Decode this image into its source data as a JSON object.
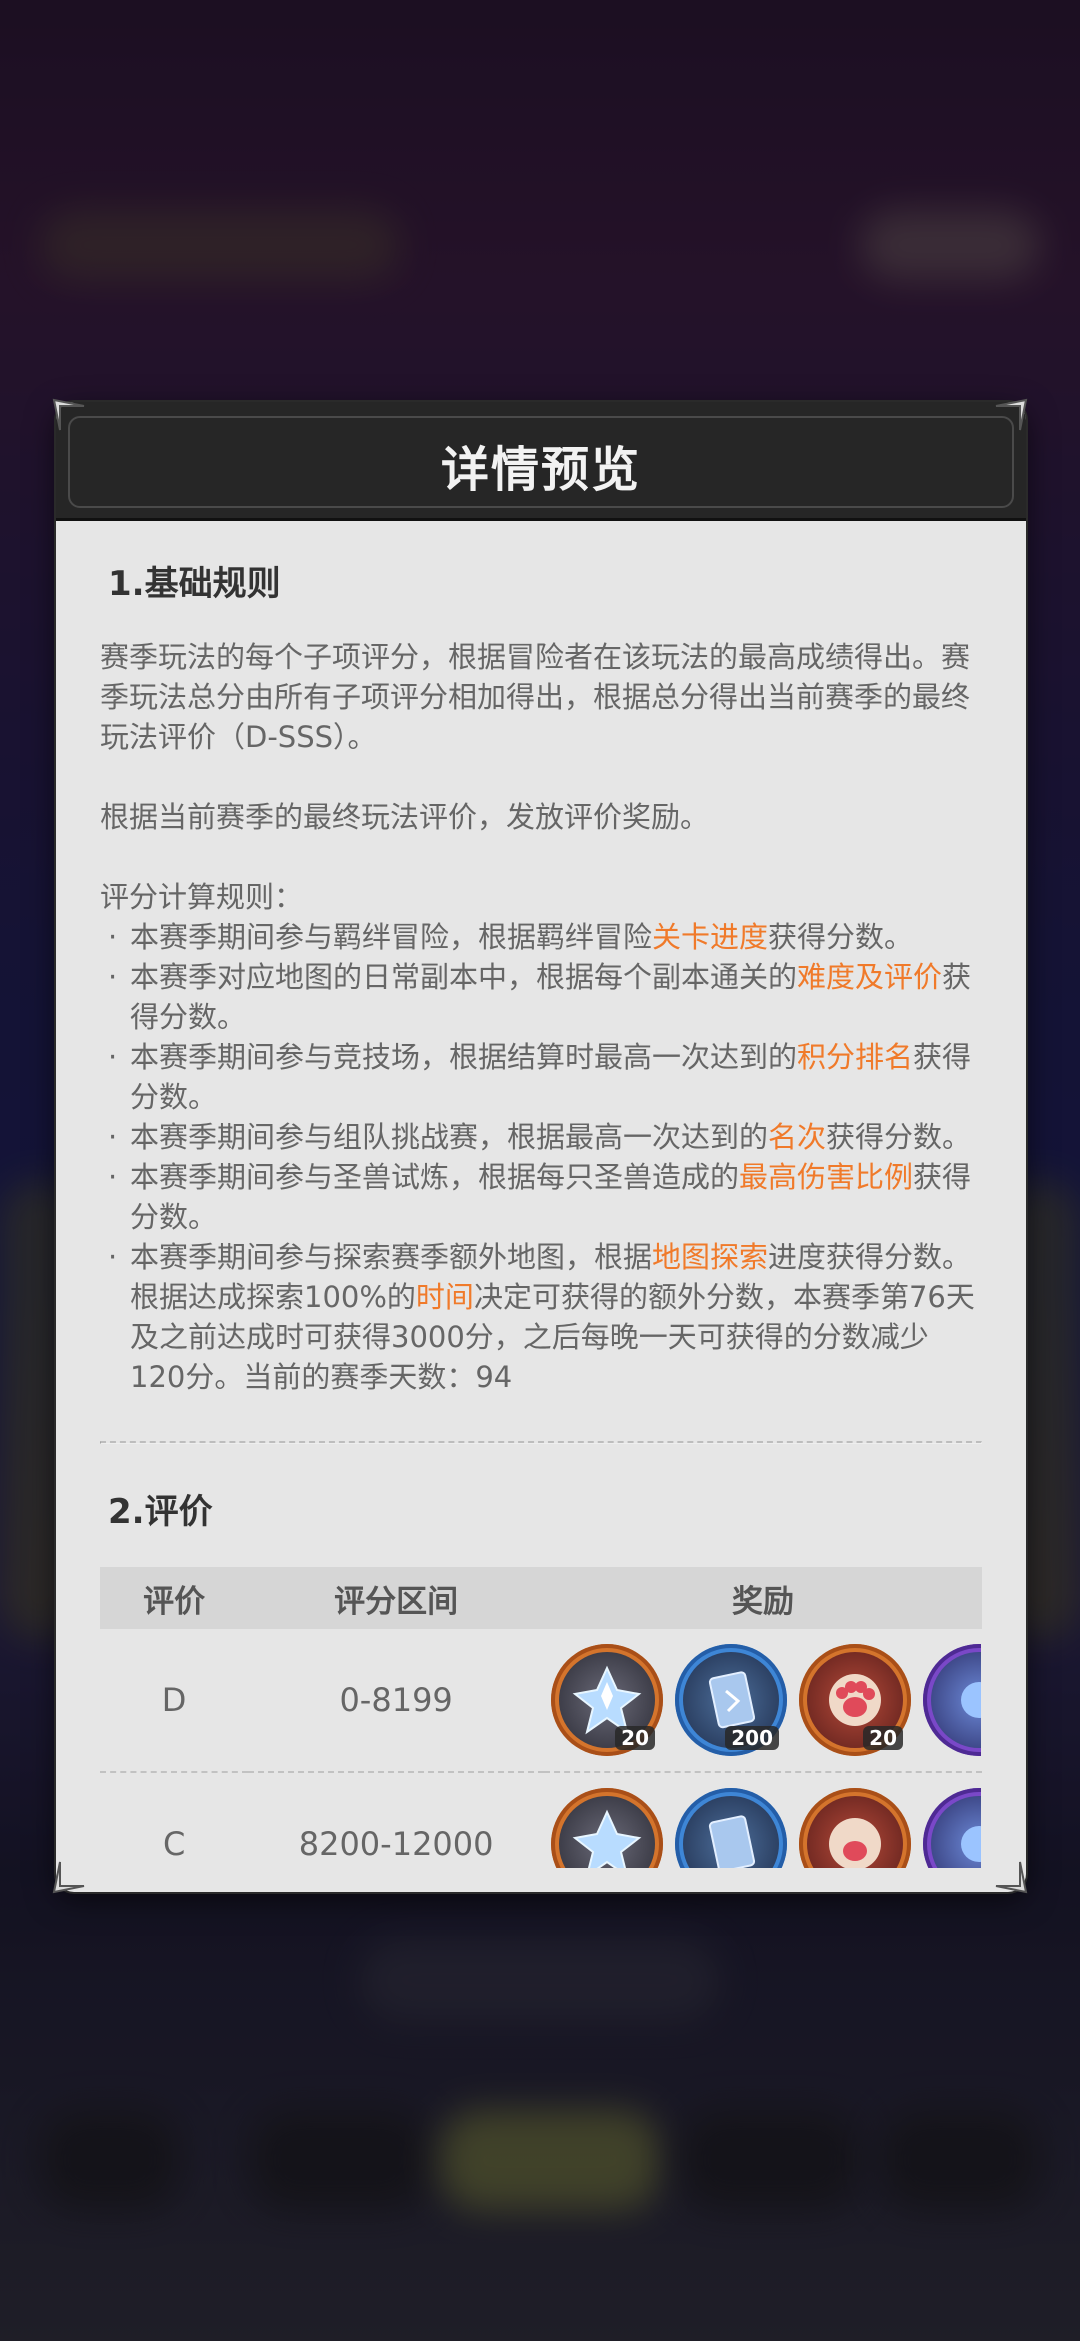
{
  "panel": {
    "title": "详情预览"
  },
  "section1": {
    "title": "1.基础规则",
    "intro": "赛季玩法的每个子项评分，根据冒险者在该玩法的最高成绩得出。赛季玩法总分由所有子项评分相加得出，根据总分得出当前赛季的最终玩法评价（D-SSS）。",
    "reward_note": "根据当前赛季的最终玩法评价，发放评价奖励。",
    "rules_heading": "评分计算规则：",
    "rules": [
      {
        "pre": "本赛季期间参与羁绊冒险，根据羁绊冒险",
        "hl": "关卡进度",
        "post": "获得分数。"
      },
      {
        "pre": "本赛季对应地图的日常副本中，根据每个副本通关的",
        "hl": "难度及评价",
        "post": "获得分数。"
      },
      {
        "pre": "本赛季期间参与竞技场，根据结算时最高一次达到的",
        "hl": "积分排名",
        "post": "获得分数。"
      },
      {
        "pre": "本赛季期间参与组队挑战赛，根据最高一次达到的",
        "hl": "名次",
        "post": "获得分数。"
      },
      {
        "pre": "本赛季期间参与圣兽试炼，根据每只圣兽造成的",
        "hl": "最高伤害比例",
        "post": "获得分数。"
      },
      {
        "pre": "本赛季期间参与探索赛季额外地图，根据",
        "hl": "地图探索",
        "mid": "进度获得分数。根据达成探索100%的",
        "hl2": "时间",
        "post": "决定可获得的额外分数，本赛季第76天及之前达成时可获得3000分，之后每晚一天可获得的分数减少120分。当前的赛季天数：94"
      }
    ]
  },
  "section2": {
    "title": "2.评价",
    "columns": [
      "评价",
      "评分区间",
      "奖励"
    ],
    "rows": [
      {
        "grade": "D",
        "range": "0-8199",
        "rewards": [
          {
            "icon": "crystal-icon",
            "qty": "20"
          },
          {
            "icon": "card-icon",
            "qty": "200"
          },
          {
            "icon": "paw-icon",
            "qty": "20"
          },
          {
            "icon": "orb-icon",
            "qty": ""
          }
        ]
      },
      {
        "grade": "C",
        "range": "8200-12000",
        "rewards": [
          {
            "icon": "crystal-icon",
            "qty": ""
          },
          {
            "icon": "card-icon",
            "qty": ""
          },
          {
            "icon": "paw-icon",
            "qty": ""
          },
          {
            "icon": "orb-icon",
            "qty": ""
          }
        ]
      }
    ]
  },
  "colors": {
    "highlight": "#f07a2a",
    "underline": "#cfe04a",
    "panel": "#e6e6e6",
    "header": "#262626"
  }
}
